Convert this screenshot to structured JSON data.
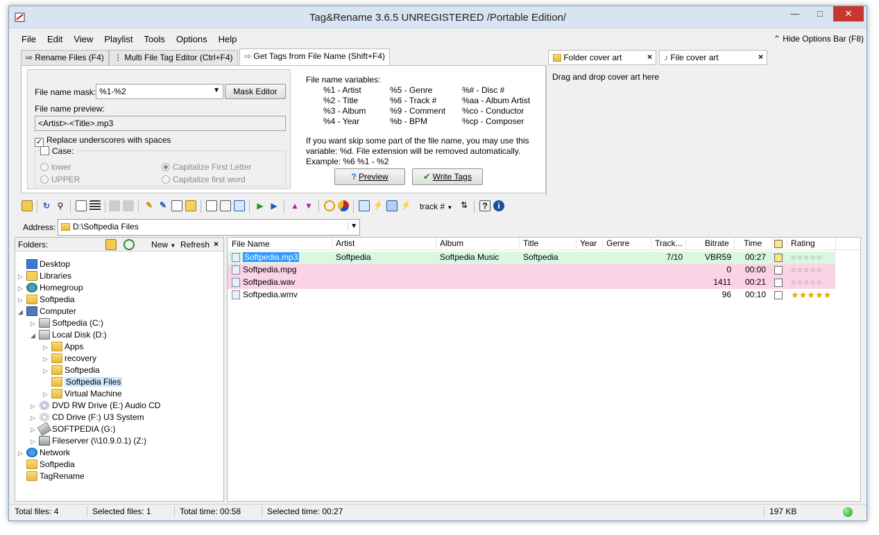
{
  "window": {
    "title": "Tag&Rename 3.6.5 UNREGISTERED /Portable Edition/"
  },
  "menu": [
    "File",
    "Edit",
    "View",
    "Playlist",
    "Tools",
    "Options",
    "Help"
  ],
  "hide_options": "Hide Options Bar (F8)",
  "tabs": [
    "Rename Files (F4)",
    "Multi File Tag Editor (Ctrl+F4)",
    "Get Tags from File Name (Shift+F4)"
  ],
  "form": {
    "mask_label": "File name mask:",
    "mask_value": "%1-%2",
    "mask_editor": "Mask Editor",
    "preview_label": "File name preview:",
    "preview_value": "<Artist>-<Title>.mp3",
    "replace_underscores": "Replace underscores with spaces",
    "case_label": "Case:",
    "case_lower": "lower",
    "case_upper": "UPPER",
    "case_capitalize_first_letter": "Capitalize First Letter",
    "case_capitalize_first_word": "Capitalize first word"
  },
  "variables": {
    "header": "File name variables:",
    "col1": [
      "%1 - Artist",
      "%2 - Title",
      "%3 - Album",
      "%4 - Year"
    ],
    "col2": [
      "%5 - Genre",
      "%6 - Track #",
      "%9 - Comment",
      "%b - BPM"
    ],
    "col3": [
      "%# - Disc #",
      "%aa - Album Artist",
      "%co - Conductor",
      "%cp - Composer"
    ],
    "note_line1": "If you want skip some part of the file name, you may use this",
    "note_line2": "variable: %d. File extension will be removed automatically.",
    "note_line3": "Example: %6 %1 - %2",
    "preview_button": "Preview",
    "write_tags_button": "Write Tags"
  },
  "cover": {
    "folder_tab": "Folder cover art",
    "file_tab": "File cover art",
    "drop_text": "Drag and drop cover art here"
  },
  "toolbar": {
    "track_dropdown": "track #"
  },
  "address": {
    "label": "Address:",
    "value": "D:\\Softpedia Files"
  },
  "folders": {
    "label": "Folders:",
    "new": "New",
    "refresh": "Refresh",
    "tree": [
      {
        "label": "Desktop",
        "icon": "desktop-icon"
      },
      {
        "label": "Libraries",
        "icon": "libraries-icon"
      },
      {
        "label": "Homegroup",
        "icon": "homegroup-icon"
      },
      {
        "label": "Softpedia",
        "icon": "user-folder-icon"
      },
      {
        "label": "Computer",
        "icon": "computer-icon"
      },
      {
        "label": "Softpedia (C:)",
        "icon": "drive-icon"
      },
      {
        "label": "Local Disk (D:)",
        "icon": "drive-icon"
      },
      {
        "label": "Apps",
        "icon": "folder-icon"
      },
      {
        "label": "recovery",
        "icon": "folder-icon"
      },
      {
        "label": "Softpedia",
        "icon": "folder-icon"
      },
      {
        "label": "Softpedia Files",
        "icon": "folder-icon"
      },
      {
        "label": "Virtual Machine",
        "icon": "folder-icon"
      },
      {
        "label": "DVD RW Drive (E:) Audio CD",
        "icon": "dvd-icon"
      },
      {
        "label": "CD Drive (F:) U3 System",
        "icon": "cd-icon"
      },
      {
        "label": "SOFTPEDIA (G:)",
        "icon": "usb-drive-icon"
      },
      {
        "label": "Fileserver (\\\\10.9.0.1) (Z:)",
        "icon": "network-drive-icon"
      },
      {
        "label": "Network",
        "icon": "network-icon"
      },
      {
        "label": "Softpedia",
        "icon": "folder-icon"
      },
      {
        "label": "TagRename",
        "icon": "folder-icon"
      }
    ]
  },
  "files": {
    "columns": [
      "File Name",
      "Artist",
      "Album",
      "Title",
      "Year",
      "Genre",
      "Track...",
      "Bitrate",
      "Time",
      "Rating"
    ],
    "rows": [
      {
        "name": "Softpedia.mp3",
        "artist": "Softpedia",
        "album": "Softpedia Music",
        "title": "Softpedia",
        "year": "",
        "genre": "",
        "track": "7/10",
        "bitrate": "VBR59",
        "time": "00:27",
        "rating": 0,
        "color": "#d9f7e1"
      },
      {
        "name": "Softpedia.mpg",
        "artist": "",
        "album": "",
        "title": "",
        "year": "",
        "genre": "",
        "track": "",
        "bitrate": "0",
        "time": "00:00",
        "rating": 0,
        "color": "#fbd3e7"
      },
      {
        "name": "Softpedia.wav",
        "artist": "",
        "album": "",
        "title": "",
        "year": "",
        "genre": "",
        "track": "",
        "bitrate": "1411",
        "time": "00:21",
        "rating": 0,
        "color": "#fbd3e7"
      },
      {
        "name": "Softpedia.wmv",
        "artist": "",
        "album": "",
        "title": "",
        "year": "",
        "genre": "",
        "track": "",
        "bitrate": "96",
        "time": "00:10",
        "rating": 5,
        "color": "#ffffff"
      }
    ]
  },
  "status": {
    "total_files": "Total files: 4",
    "selected_files": "Selected files: 1",
    "total_time": "Total time: 00:58",
    "selected_time": "Selected time: 00:27",
    "size": "197 KB"
  }
}
